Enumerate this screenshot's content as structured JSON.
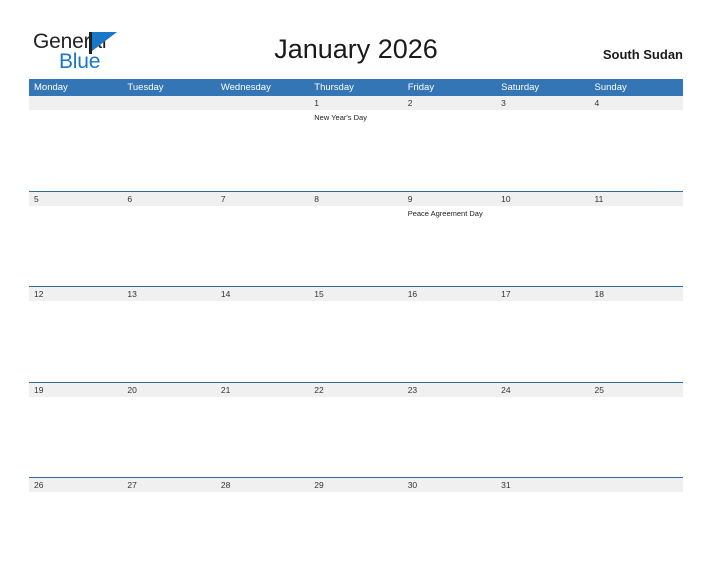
{
  "brand": {
    "name_part1": "General",
    "name_part2": "Blue",
    "flag_icon": "flag-icon",
    "color_dark": "#231f20",
    "color_blue": "#1878c8"
  },
  "header": {
    "title": "January 2026",
    "region": "South Sudan"
  },
  "theme": {
    "header_blue": "#3375b5",
    "rule_blue": "#2e6da4",
    "date_band_gray": "#f0f0f0",
    "page_background": "#ffffff",
    "text_color": "#222222"
  },
  "calendar": {
    "month": "January",
    "year": "2026",
    "weekday_headers": [
      "Monday",
      "Tuesday",
      "Wednesday",
      "Thursday",
      "Friday",
      "Saturday",
      "Sunday"
    ],
    "weeks": [
      {
        "days": [
          {
            "date": "",
            "events": []
          },
          {
            "date": "",
            "events": []
          },
          {
            "date": "",
            "events": []
          },
          {
            "date": "1",
            "events": [
              "New Year's Day"
            ]
          },
          {
            "date": "2",
            "events": []
          },
          {
            "date": "3",
            "events": []
          },
          {
            "date": "4",
            "events": []
          }
        ]
      },
      {
        "days": [
          {
            "date": "5",
            "events": []
          },
          {
            "date": "6",
            "events": []
          },
          {
            "date": "7",
            "events": []
          },
          {
            "date": "8",
            "events": []
          },
          {
            "date": "9",
            "events": [
              "Peace Agreement Day"
            ]
          },
          {
            "date": "10",
            "events": []
          },
          {
            "date": "11",
            "events": []
          }
        ]
      },
      {
        "days": [
          {
            "date": "12",
            "events": []
          },
          {
            "date": "13",
            "events": []
          },
          {
            "date": "14",
            "events": []
          },
          {
            "date": "15",
            "events": []
          },
          {
            "date": "16",
            "events": []
          },
          {
            "date": "17",
            "events": []
          },
          {
            "date": "18",
            "events": []
          }
        ]
      },
      {
        "days": [
          {
            "date": "19",
            "events": []
          },
          {
            "date": "20",
            "events": []
          },
          {
            "date": "21",
            "events": []
          },
          {
            "date": "22",
            "events": []
          },
          {
            "date": "23",
            "events": []
          },
          {
            "date": "24",
            "events": []
          },
          {
            "date": "25",
            "events": []
          }
        ]
      },
      {
        "days": [
          {
            "date": "26",
            "events": []
          },
          {
            "date": "27",
            "events": []
          },
          {
            "date": "28",
            "events": []
          },
          {
            "date": "29",
            "events": []
          },
          {
            "date": "30",
            "events": []
          },
          {
            "date": "31",
            "events": []
          },
          {
            "date": "",
            "events": []
          }
        ]
      }
    ]
  }
}
